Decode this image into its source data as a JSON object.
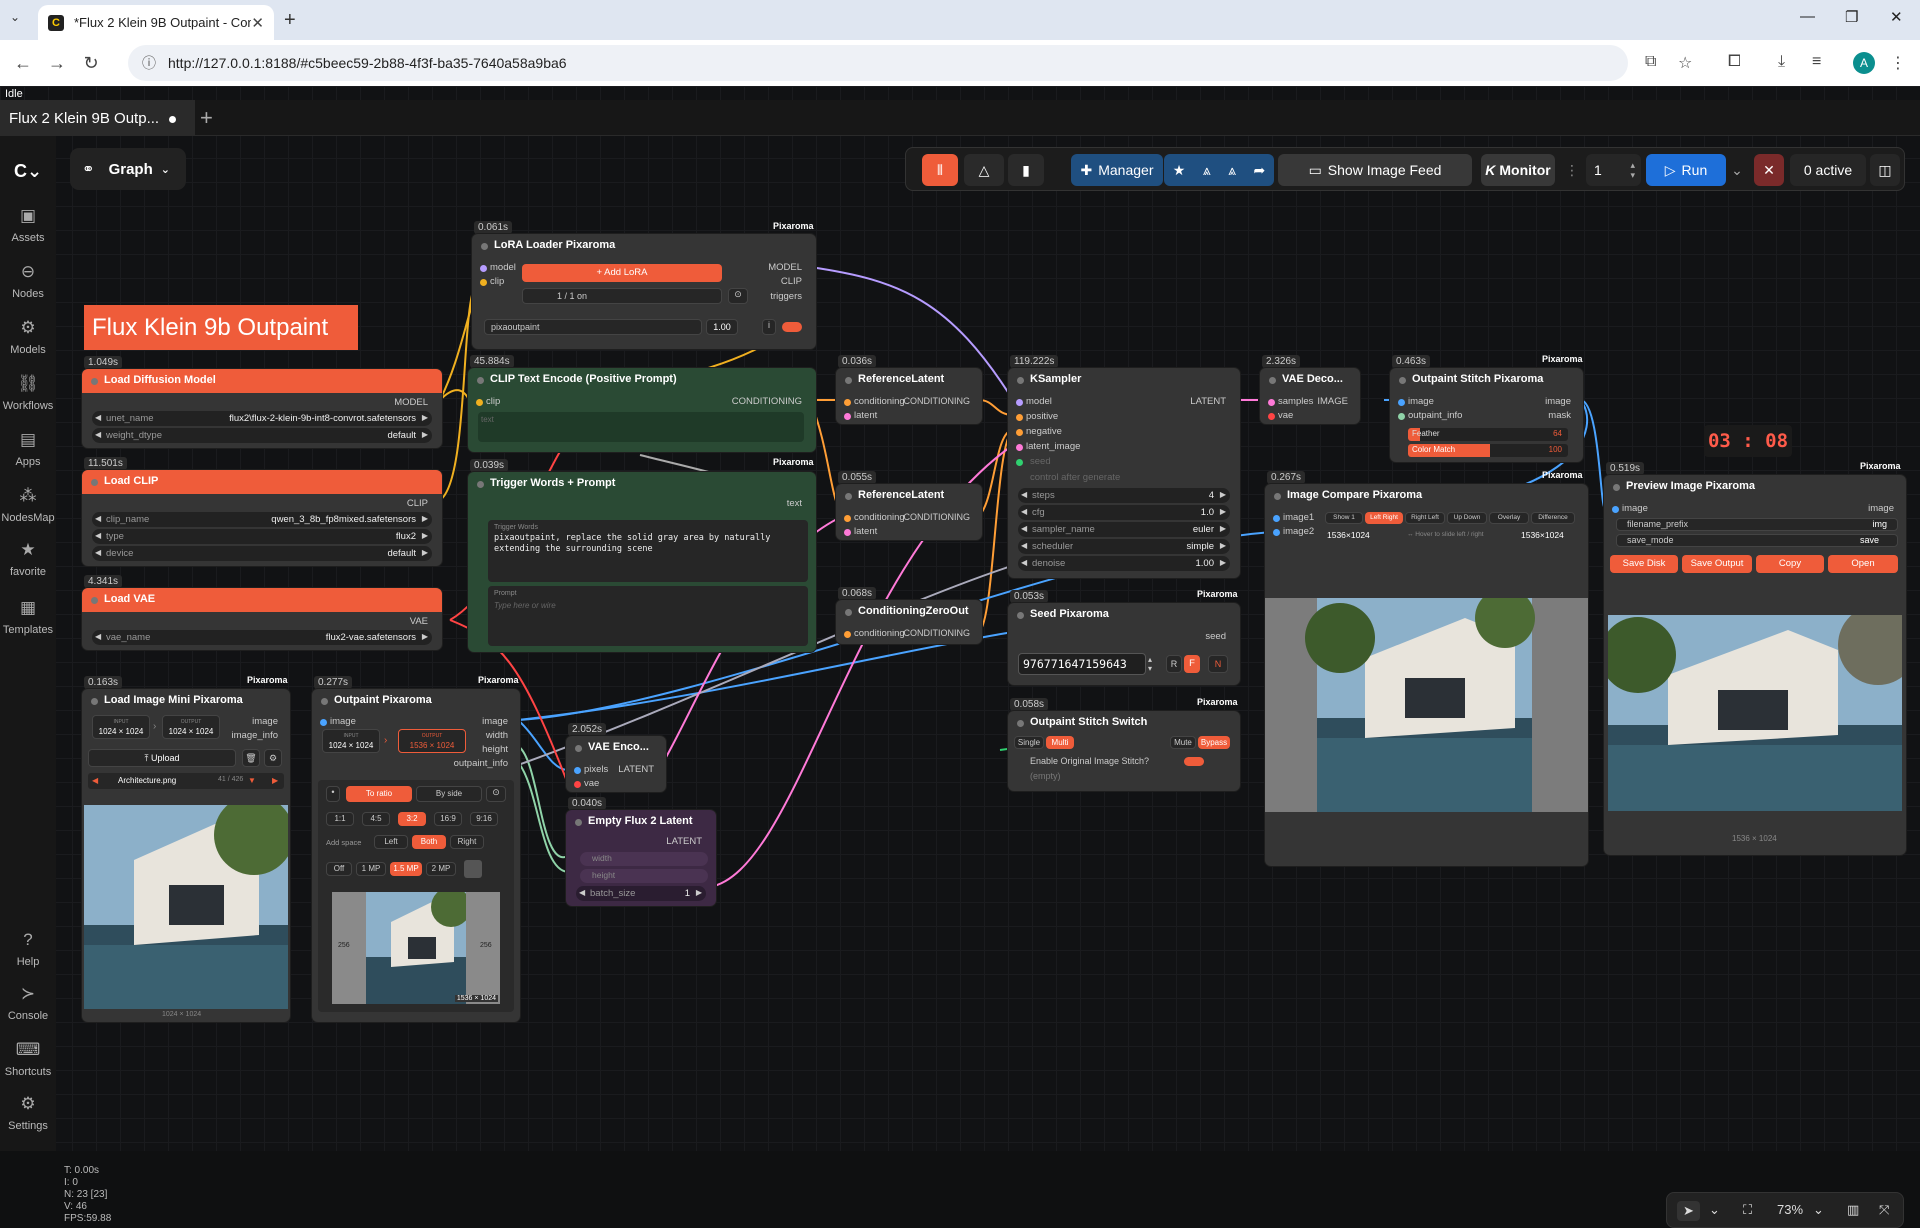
{
  "browser": {
    "tab_title": "*Flux 2 Klein 9B Outpaint - Com",
    "url": "http://127.0.0.1:8188/#c5beec59-2b88-4f3f-ba35-7640a58a9ba6",
    "avatar": "A"
  },
  "app": {
    "status": "Idle",
    "workflow_tab": "Flux 2 Klein 9B Outp...",
    "graph_label": "Graph"
  },
  "sidebar": [
    {
      "label": "Assets",
      "icon": "assets-icon"
    },
    {
      "label": "Nodes",
      "icon": "nodes-icon"
    },
    {
      "label": "Models",
      "icon": "models-icon"
    },
    {
      "label": "Workflows",
      "icon": "workflows-icon"
    },
    {
      "label": "Apps",
      "icon": "apps-icon"
    },
    {
      "label": "NodesMap",
      "icon": "nodesmap-icon"
    },
    {
      "label": "favorite",
      "icon": "star-icon"
    },
    {
      "label": "Templates",
      "icon": "templates-icon"
    },
    {
      "label": "Help",
      "icon": "help-icon"
    },
    {
      "label": "Console",
      "icon": "console-icon"
    },
    {
      "label": "Shortcuts",
      "icon": "keyboard-icon"
    },
    {
      "label": "Settings",
      "icon": "gear-icon"
    }
  ],
  "toolbar": {
    "manager": "Manager",
    "image_feed": "Show Image Feed",
    "monitor": "Monitor",
    "queue_count": "1",
    "run": "Run",
    "active": "0 active"
  },
  "stats": [
    "T: 0.00s",
    "I: 0",
    "N: 23 [23]",
    "V: 46",
    "FPS:59.88"
  ],
  "zoom": "73%",
  "banner": "Flux Klein 9b Outpaint",
  "clock": "03 : 08",
  "brand": "Pixaroma",
  "nodes": {
    "lora": {
      "time": "0.061s",
      "title": "LoRA Loader Pixaroma",
      "in1": "model",
      "in2": "clip",
      "out1": "MODEL",
      "out2": "CLIP",
      "out3": "triggers",
      "add": "+ Add LoRA",
      "count": "1 / 1 on",
      "lora_name": "pixaoutpaint",
      "strength": "1.00"
    },
    "diffusion": {
      "time": "1.049s",
      "title": "Load Diffusion Model",
      "out": "MODEL",
      "w1k": "unet_name",
      "w1v": "flux2\\flux-2-klein-9b-int8-convrot.safetensors",
      "w2k": "weight_dtype",
      "w2v": "default"
    },
    "clip": {
      "time": "11.501s",
      "title": "Load CLIP",
      "out": "CLIP",
      "w1k": "clip_name",
      "w1v": "qwen_3_8b_fp8mixed.safetensors",
      "w2k": "type",
      "w2v": "flux2",
      "w3k": "device",
      "w3v": "default"
    },
    "vae": {
      "time": "4.341s",
      "title": "Load VAE",
      "out": "VAE",
      "w1k": "vae_name",
      "w1v": "flux2-vae.safetensors"
    },
    "clipenc": {
      "time": "45.884s",
      "title": "CLIP Text Encode (Positive Prompt)",
      "in": "clip",
      "out": "CONDITIONING",
      "text": "text"
    },
    "trigger": {
      "time": "0.039s",
      "title": "Trigger Words + Prompt",
      "out": "text",
      "tw_label": "Trigger Words",
      "tw_text": "pixaoutpaint, replace the solid gray area by naturally extending the surrounding scene",
      "p_label": "Prompt",
      "p_ph": "Type here or wire"
    },
    "ref1": {
      "time": "0.036s",
      "title": "ReferenceLatent",
      "in1": "conditioning",
      "in2": "latent",
      "out": "CONDITIONING"
    },
    "ref2": {
      "time": "0.055s",
      "title": "ReferenceLatent",
      "in1": "conditioning",
      "in2": "latent",
      "out": "CONDITIONING"
    },
    "czero": {
      "time": "0.068s",
      "title": "ConditioningZeroOut",
      "in": "conditioning",
      "out": "CONDITIONING"
    },
    "ksampler": {
      "time": "119.222s",
      "title": "KSampler",
      "ins": [
        "model",
        "positive",
        "negative",
        "latent_image"
      ],
      "out": "LATENT",
      "seed": "seed",
      "cag": "control after generate",
      "widgets": [
        {
          "k": "steps",
          "v": "4"
        },
        {
          "k": "cfg",
          "v": "1.0"
        },
        {
          "k": "sampler_name",
          "v": "euler"
        },
        {
          "k": "scheduler",
          "v": "simple"
        },
        {
          "k": "denoise",
          "v": "1.00"
        }
      ]
    },
    "vaedec": {
      "time": "2.326s",
      "title": "VAE Deco...",
      "in1": "samples",
      "in2": "vae",
      "out": "IMAGE"
    },
    "stitch": {
      "time": "0.463s",
      "title": "Outpaint Stitch Pixaroma",
      "in1": "image",
      "in2": "outpaint_info",
      "out1": "image",
      "out2": "mask",
      "feather_k": "Feather",
      "feather_v": "64",
      "cm_k": "Color Match",
      "cm_v": "100"
    },
    "compare": {
      "time": "0.267s",
      "title": "Image Compare Pixaroma",
      "in1": "image1",
      "in2": "image2",
      "modes": [
        "Show 1",
        "Left Right",
        "Right Left",
        "Up Down",
        "Overlay",
        "Difference"
      ],
      "size1": "1536×1024",
      "hint": "↔ Hover to slide left / right",
      "size2": "1536×1024"
    },
    "preview": {
      "time": "0.519s",
      "title": "Preview Image Pixaroma",
      "in": "image",
      "out": "image",
      "fp_k": "filename_prefix",
      "fp_v": "img",
      "sm_k": "save_mode",
      "sm_v": "save",
      "buttons": [
        "Save Disk",
        "Save Output",
        "Copy",
        "Open"
      ],
      "size": "1536 × 1024"
    },
    "seed": {
      "time": "0.053s",
      "title": "Seed Pixaroma",
      "out": "seed",
      "value": "976771647159643",
      "r": "R",
      "f": "F",
      "n": "N"
    },
    "switch": {
      "time": "0.058s",
      "title": "Outpaint Stitch Switch",
      "b1": "Single",
      "b2": "Multi",
      "b3": "Mute",
      "b4": "Bypass",
      "toggle": "Enable Original Image Stitch?",
      "empty": "(empty)"
    },
    "loadimg": {
      "time": "0.163s",
      "title": "Load Image Mini Pixaroma",
      "out1": "image",
      "out2": "image_info",
      "in_l": "INPUT",
      "in_v": "1024 × 1024",
      "out_l": "OUTPUT",
      "out_v": "1024 × 1024",
      "upload": "Upload",
      "file": "Architecture.png",
      "idx": "41 / 426",
      "size": "1024 × 1024"
    },
    "outpaint": {
      "time": "0.277s",
      "title": "Outpaint Pixaroma",
      "in": "image",
      "outs": [
        "image",
        "width",
        "height",
        "outpaint_info"
      ],
      "in_l": "INPUT",
      "in_v": "1024 × 1024",
      "out_l": "OUTPUT",
      "out_v": "1536 × 1024",
      "to_ratio": "To ratio",
      "by_side": "By side",
      "ratios": [
        "1:1",
        "4:5",
        "3:2",
        "16:9",
        "9:16"
      ],
      "add_space": "Add space",
      "sides": [
        "Left",
        "Both",
        "Right"
      ],
      "mp": [
        "Off",
        "1 MP",
        "1.5 MP",
        "2 MP"
      ],
      "pad_l": "256",
      "pad_r": "256",
      "size": "1536 × 1024"
    },
    "vaeenc": {
      "time": "2.052s",
      "title": "VAE Enco...",
      "in1": "pixels",
      "in2": "vae",
      "out": "LATENT"
    },
    "empty": {
      "time": "0.040s",
      "title": "Empty Flux 2 Latent",
      "out": "LATENT",
      "w1": "width",
      "w2": "height",
      "w3k": "batch_size",
      "w3v": "1"
    }
  }
}
